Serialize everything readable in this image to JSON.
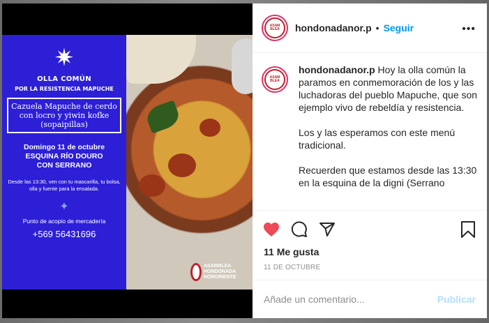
{
  "post": {
    "poster": {
      "star": "✷",
      "title": "OLLA COMÚN",
      "subtitle": "POR LA RESISTENCIA MAPUCHE",
      "menu": "Cazuela Mapuche de cerdo con locro y yiwin kofke (sopaipillas)",
      "date": "Domingo 11 de octubre",
      "place1": "ESQUINA RÍO DOURO",
      "place2": "CON SERRANO",
      "note": "Desde las 13:30, ven con tu mascarilla, tu bolsa, olla y fuente para la ensalada.",
      "acopio": "Punto de acopio de mercadería",
      "phone": "+569 56431696",
      "logo_text": "ASAMBLEA HONDONADA NORORIENTE"
    }
  },
  "header": {
    "username": "hondonadanor.p",
    "separator": "•",
    "follow_label": "Seguir",
    "more_icon": "more-horizontal-icon"
  },
  "caption": {
    "username": "hondonadanor.p",
    "paragraph1": "Hoy la olla común la paramos en conmemoración de los y las luchadoras del pueblo Mapuche, que son ejemplo vivo de rebeldía y resistencia.",
    "paragraph2": "Los y las esperamos con este menú tradicional.",
    "paragraph3": "Recuerden que estamos desde las 13:30 en la esquina de la digni (Serrano"
  },
  "actions": {
    "likes": "11 Me gusta",
    "date": "11 DE OCTUBRE",
    "liked": true,
    "heart_color": "#ed4956"
  },
  "comment": {
    "placeholder": "Añade un comentario...",
    "publish_label": "Publicar"
  }
}
